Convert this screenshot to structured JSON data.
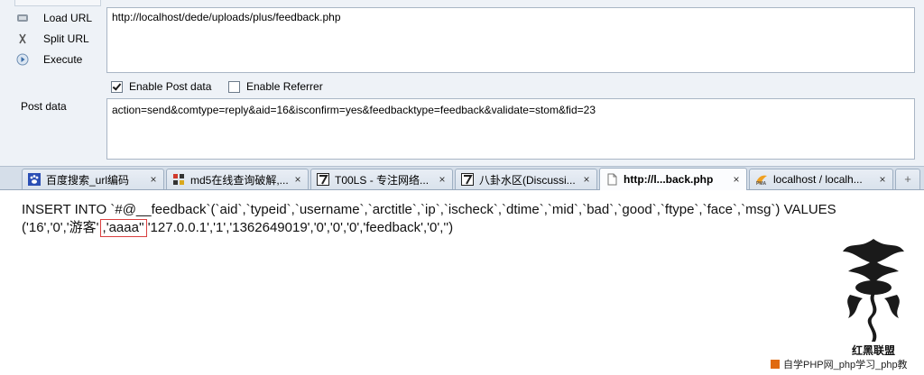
{
  "hackbar": {
    "buttons": [
      {
        "label": "Load URL",
        "icon": "load-url-icon"
      },
      {
        "label": "Split URL",
        "icon": "split-url-icon"
      },
      {
        "label": "Execute",
        "icon": "execute-icon"
      }
    ],
    "url_value": "http://localhost/dede/uploads/plus/feedback.php",
    "enable_post_label": "Enable Post data",
    "enable_post_checked": true,
    "enable_referrer_label": "Enable Referrer",
    "enable_referrer_checked": false,
    "post_label": "Post data",
    "post_value": "action=send&comtype=reply&aid=16&isconfirm=yes&feedbacktype=feedback&validate=stom&fid=23"
  },
  "tabs": [
    {
      "label": "百度搜索_url编码",
      "icon": "paw-icon",
      "active": false
    },
    {
      "label": "md5在线查询破解,...",
      "icon": "grid-icon",
      "active": false
    },
    {
      "label": "T00LS - 专注网络...",
      "icon": "seven-icon",
      "active": false
    },
    {
      "label": "八卦水区(Discussi...",
      "icon": "seven-icon",
      "active": false
    },
    {
      "label": "http://l...back.php",
      "icon": "page-icon",
      "active": true
    },
    {
      "label": "localhost / localh...",
      "icon": "pma-icon",
      "active": false
    }
  ],
  "tab_close_glyph": "×",
  "content": {
    "line1": "INSERT INTO `#@__feedback`(`aid`,`typeid`,`username`,`arctitle`,`ip`,`ischeck`,`dtime`,`mid`,`bad`,`good`,`ftype`,`face`,`msg`) VALUES",
    "line2_before": "('16','0','游客'",
    "line2_highlight": ",'aaaa''",
    "line2_after": "'127.0.0.1','1','1362649019','0','0','0','feedback','0','')"
  },
  "watermark": {
    "logo_text": "红黑联盟",
    "footer_text": "自学PHP网_php学习_php教"
  },
  "colors": {
    "highlight_border": "#d94040",
    "panel_bg": "#eef2f7",
    "tabbar_bg": "#d5dee9"
  }
}
